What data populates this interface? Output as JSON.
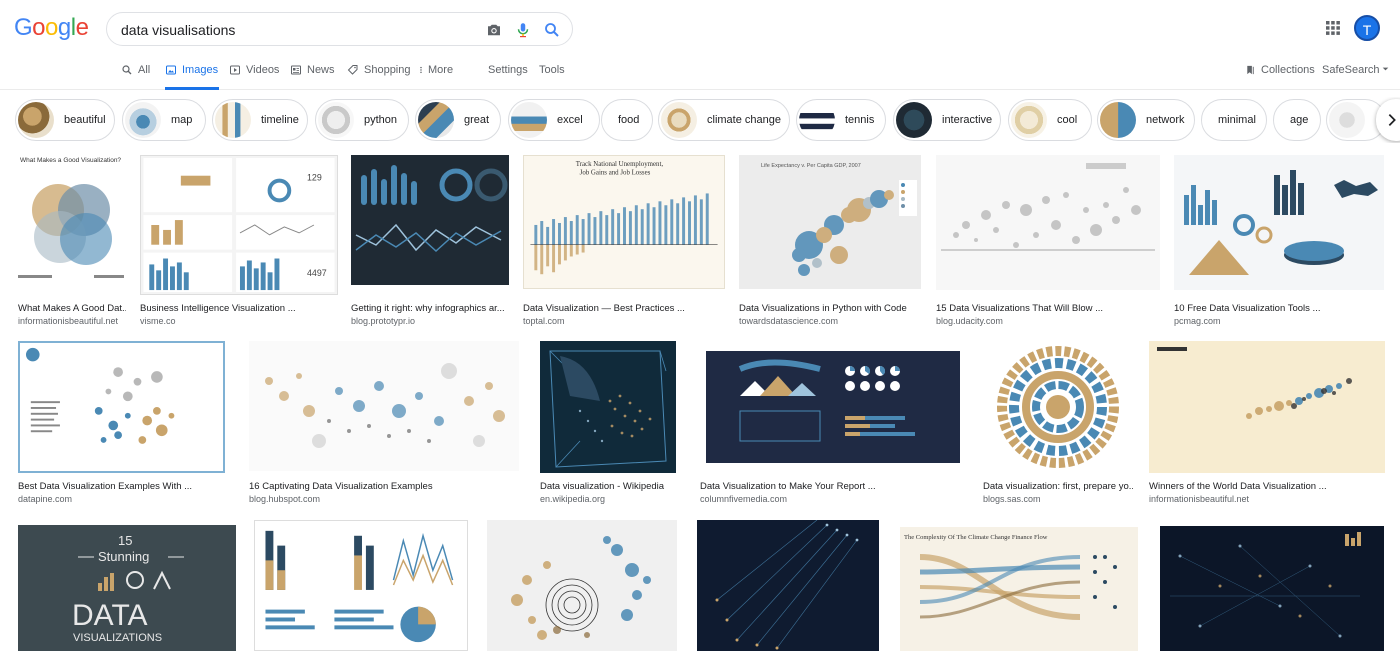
{
  "logo": "Google",
  "search": {
    "query": "data visualisations"
  },
  "avatar_letter": "T",
  "tabs": [
    {
      "label": "All",
      "icon": "search-icon"
    },
    {
      "label": "Images",
      "icon": "image-icon",
      "active": true
    },
    {
      "label": "Videos",
      "icon": "video-icon"
    },
    {
      "label": "News",
      "icon": "news-icon"
    },
    {
      "label": "Shopping",
      "icon": "tag-icon"
    },
    {
      "label": "More",
      "icon": "more-vert-icon"
    },
    {
      "label": "Settings"
    },
    {
      "label": "Tools"
    }
  ],
  "right_tools": {
    "collections": "Collections",
    "safesearch": "SafeSearch"
  },
  "chips": [
    {
      "label": "beautiful"
    },
    {
      "label": "map"
    },
    {
      "label": "timeline"
    },
    {
      "label": "python"
    },
    {
      "label": "great"
    },
    {
      "label": "excel"
    },
    {
      "label": "food"
    },
    {
      "label": "climate change"
    },
    {
      "label": "tennis"
    },
    {
      "label": "interactive"
    },
    {
      "label": "cool"
    },
    {
      "label": "network"
    },
    {
      "label": "minimal"
    },
    {
      "label": "age"
    }
  ],
  "results": [
    {
      "title": "What Makes A Good Dat...",
      "source": "informationisbeautiful.net"
    },
    {
      "title": "Business Intelligence Visualization ...",
      "source": "visme.co"
    },
    {
      "title": "Getting it right: why infographics ar...",
      "source": "blog.prototypr.io"
    },
    {
      "title": "Data Visualization — Best Practices ...",
      "source": "toptal.com"
    },
    {
      "title": "Data Visualizations in Python with Code",
      "source": "towardsdatascience.com"
    },
    {
      "title": "15 Data Visualizations That Will Blow ...",
      "source": "blog.udacity.com"
    },
    {
      "title": "10 Free Data Visualization Tools ...",
      "source": "pcmag.com"
    },
    {
      "title": "Best Data Visualization Examples With ...",
      "source": "datapine.com"
    },
    {
      "title": "16 Captivating Data Visualization Examples",
      "source": "blog.hubspot.com"
    },
    {
      "title": "Data visualization - Wikipedia",
      "source": "en.wikipedia.org"
    },
    {
      "title": "Data Visualization to Make Your Report ...",
      "source": "columnfivemedia.com"
    },
    {
      "title": "Data visualization: first, prepare yo...",
      "source": "blogs.sas.com"
    },
    {
      "title": "Winners of the World Data Visualization ...",
      "source": "informationisbeautiful.net"
    },
    {
      "title": "",
      "source": ""
    },
    {
      "title": "",
      "source": ""
    },
    {
      "title": "",
      "source": ""
    },
    {
      "title": "",
      "source": ""
    },
    {
      "title": "",
      "source": ""
    },
    {
      "title": "",
      "source": ""
    }
  ],
  "thumb_text": {
    "r0": "What Makes a Good Visualization?",
    "r3a": "Track National Unemployment,",
    "r3b": "Job Gains and Job Losses",
    "r4": "Life Expectancy v. Per Capita GDP, 2007",
    "r13a": "15",
    "r13b": "Stunning",
    "r13c": "DATA",
    "r13d": "VISUALIZATIONS",
    "r17": "The Complexity Of The Climate Change Finance Flow"
  },
  "colors": {
    "accent": "#1a73e8",
    "navy": "#1f2a44",
    "gold": "#c9a46b",
    "steel": "#4a89b4"
  }
}
